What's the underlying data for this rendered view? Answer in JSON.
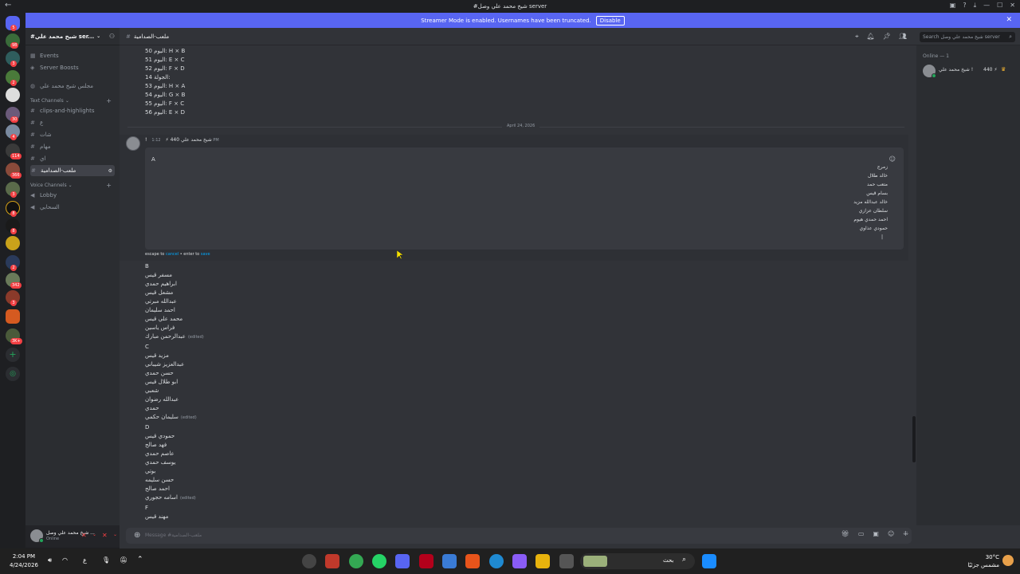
{
  "window": {
    "back_glyph": "←",
    "title": "#شيخ محمد علي وصل server"
  },
  "streamer_banner": {
    "text": "Streamer Mode is enabled. Usernames have been truncated.",
    "disable_label": "Disable",
    "close_glyph": "✕"
  },
  "guild_badges": [
    "5",
    "98",
    "3",
    "2",
    "30",
    "4",
    "114",
    "366",
    "3",
    "8",
    "8",
    "2",
    "342",
    "3",
    "3K+"
  ],
  "server": {
    "name": "#شيخ محمد علي ser...",
    "rows": {
      "events": "Events",
      "boosts": "Server Boosts",
      "hidden_channel": "مجلس شيخ محمد علي",
      "text_cat": "Text Channels",
      "ch1": "clips-and-highlights",
      "ch2": "ع",
      "ch3": "شات",
      "ch4": "مهام",
      "ch5": "اي",
      "ch_active": "ملعب-الصدامية",
      "voice_cat": "Voice Channels",
      "v1": "Lobby",
      "v2": "السحابي"
    }
  },
  "user_panel": {
    "name": "شيخ محمد علي وصل ...",
    "status": "Online"
  },
  "channel_header": {
    "name": "ملعب-الصدامية",
    "search_placeholder": "Search شيخ محمد علي وصل server"
  },
  "schedule": [
    "50 اليوم: H × B",
    "51 اليوم: E × C",
    "52 اليوم: F × D",
    "14 الجولة:",
    "53 اليوم: H × A",
    "54 اليوم: G × B",
    "55 اليوم: F × C",
    "56 اليوم: E × D"
  ],
  "date_separator": "April 24, 2026",
  "message": {
    "author": "!",
    "tag": "شيخ محمد علي 440 ⚡",
    "time": "1:12 PM",
    "edit_first_line": "A",
    "edit_right_lines": [
      "زمرج",
      "خالد طلال",
      "متعب حمد",
      "بسام قيس",
      "خالد عبدالله مزيد",
      "سلطان عزازي",
      "احمد حمدي هيوم",
      "حمودي عذاوي",
      "|"
    ],
    "escape_prefix": "escape to",
    "cancel": "cancel",
    "enter_prefix": "• enter to",
    "save": "save"
  },
  "groups": [
    {
      "letter": "B",
      "names": [
        "مسفر قيس",
        "ابراهيم حمدي",
        "مشعل قيس",
        "عبدالله مبرتي",
        "احمد سليمان",
        "محمد علي قيس",
        "فراس ياسين",
        "عبدالرحمن مبارك"
      ],
      "edited_last": true
    },
    {
      "letter": "C",
      "names": [
        "مزيد قيس",
        "عبدالعزيز شيباني",
        "حسن حمدي",
        "ابو طلال قيس",
        "شعبي",
        "عبدالله رضوان",
        "حمدي",
        "سليمان حكمي"
      ],
      "edited_last": true
    },
    {
      "letter": "D",
      "names": [
        "حمودي قيس",
        "فهد صالح",
        "عاصم حمدي",
        "يوسف حمدي",
        "بوتي",
        "حسن سليمه",
        "احمد صالح",
        "اسامه حجوري"
      ],
      "edited_last": true
    },
    {
      "letter": "F",
      "names": [
        "مهند قيس"
      ],
      "edited_last": false
    }
  ],
  "edited_label": "(edited)",
  "members": {
    "section": "Online — 1",
    "member_name": "شيخ محمد علي !",
    "member_tag": "440 ⚡"
  },
  "composer": {
    "placeholder": "Message #ملعب-الصدامية"
  },
  "taskbar": {
    "time": "2:04 PM",
    "date": "4/24/2026",
    "search_label": "بحث",
    "weather_temp": "30°C",
    "weather_desc": "مشمس جزئيًا",
    "lang": "ع"
  },
  "colors": {
    "blurple": "#5865f2",
    "bg": "#313338",
    "sidebar": "#2b2d31",
    "mention_red": "#f23f43",
    "online_green": "#23a55a"
  }
}
